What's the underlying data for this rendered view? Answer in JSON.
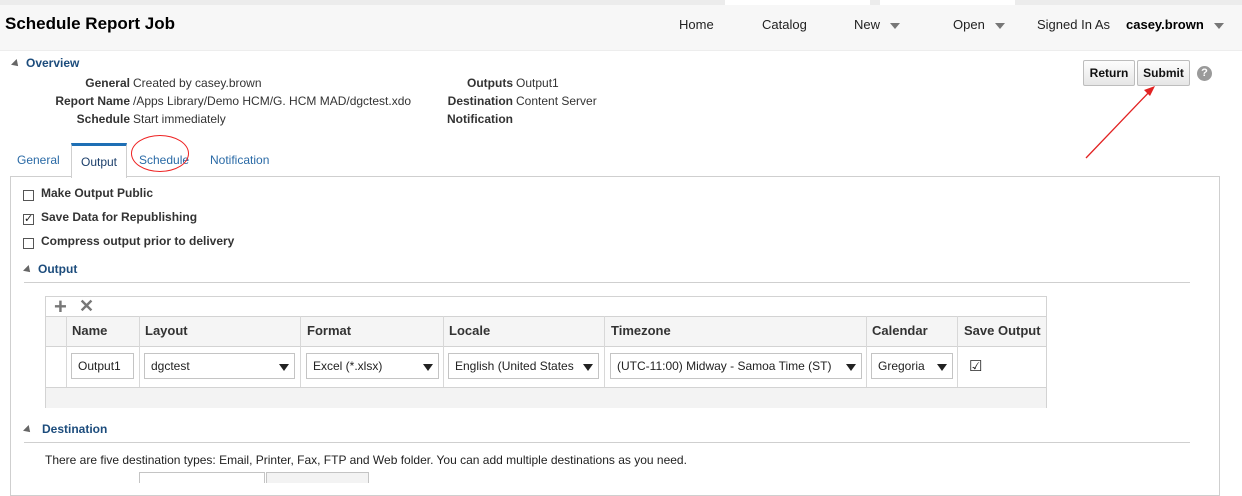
{
  "header": {
    "title": "Schedule Report Job",
    "nav": {
      "home": "Home",
      "catalog": "Catalog",
      "new": "New",
      "open": "Open",
      "signed_in_as": "Signed In As",
      "user": "casey.brown"
    }
  },
  "overview": {
    "heading": "Overview",
    "general_label": "General",
    "general_value": "Created by casey.brown",
    "report_label": "Report Name",
    "report_value": "/Apps Library/Demo HCM/G. HCM MAD/dgctest.xdo",
    "schedule_label": "Schedule",
    "schedule_value": "Start immediately",
    "outputs_label": "Outputs",
    "outputs_value": "Output1",
    "destination_label": "Destination",
    "destination_value": "Content Server",
    "notification_label": "Notification"
  },
  "actions": {
    "return": "Return",
    "submit": "Submit",
    "help": "?"
  },
  "tabs": {
    "general": "General",
    "output": "Output",
    "schedule": "Schedule",
    "notification": "Notification"
  },
  "options": {
    "make_public": "Make Output Public",
    "save_data": "Save Data for Republishing",
    "compress": "Compress output prior to delivery"
  },
  "output_section": {
    "heading": "Output",
    "columns": {
      "name": "Name",
      "layout": "Layout",
      "format": "Format",
      "locale": "Locale",
      "timezone": "Timezone",
      "calendar": "Calendar",
      "save_output": "Save Output"
    },
    "row": {
      "name": "Output1",
      "layout": "dgctest",
      "format": "Excel (*.xlsx)",
      "locale": "English (United States",
      "timezone": "(UTC-11:00) Midway - Samoa Time (ST)",
      "calendar": "Gregoria",
      "save_output_checked": "☑"
    },
    "toolbar": {
      "add": "+",
      "delete": "✕"
    }
  },
  "destination_section": {
    "heading": "Destination",
    "description": "There are five destination types: Email, Printer, Fax, FTP and Web folder. You can add multiple destinations as you need."
  },
  "checkmark": "✓",
  "colors": {
    "accent": "#1e6fb5",
    "link": "#2a6aa6",
    "annotation": "#e22222"
  }
}
